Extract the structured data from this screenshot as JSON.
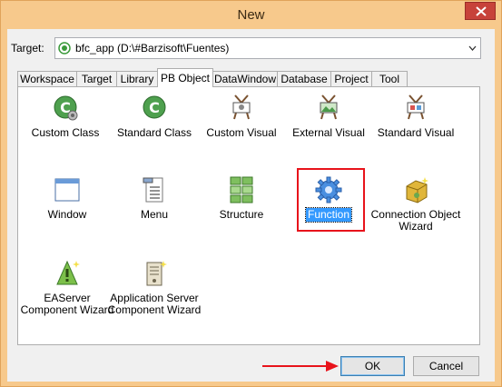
{
  "window": {
    "title": "New"
  },
  "target": {
    "label": "Target:",
    "value": "bfc_app (D:\\#Barzisoft\\Fuentes)"
  },
  "tabs": [
    {
      "label": "Workspace"
    },
    {
      "label": "Target"
    },
    {
      "label": "Library"
    },
    {
      "label": "PB Object"
    },
    {
      "label": "DataWindow"
    },
    {
      "label": "Database"
    },
    {
      "label": "Project"
    },
    {
      "label": "Tool"
    }
  ],
  "active_tab": "PB Object",
  "items": [
    {
      "label": "Custom Class",
      "icon": "custom-class-icon"
    },
    {
      "label": "Standard Class",
      "icon": "standard-class-icon"
    },
    {
      "label": "Custom Visual",
      "icon": "custom-visual-icon"
    },
    {
      "label": "External Visual",
      "icon": "external-visual-icon"
    },
    {
      "label": "Standard Visual",
      "icon": "standard-visual-icon"
    },
    {
      "label": "Window",
      "icon": "window-icon"
    },
    {
      "label": "Menu",
      "icon": "menu-icon"
    },
    {
      "label": "Structure",
      "icon": "structure-icon"
    },
    {
      "label": "Function",
      "icon": "function-gear-icon"
    },
    {
      "label": "Connection Object Wizard",
      "icon": "connection-wizard-icon"
    },
    {
      "label": "EAServer Component Wizard",
      "icon": "easerver-wizard-icon"
    },
    {
      "label": "Application Server Component Wizard",
      "icon": "appserver-wizard-icon"
    }
  ],
  "selected_item": "Function",
  "buttons": {
    "ok": "OK",
    "cancel": "Cancel"
  },
  "colors": {
    "title_bar": "#f7c98c",
    "selection": "#3399ff",
    "highlight_annotation": "#e8131b"
  }
}
